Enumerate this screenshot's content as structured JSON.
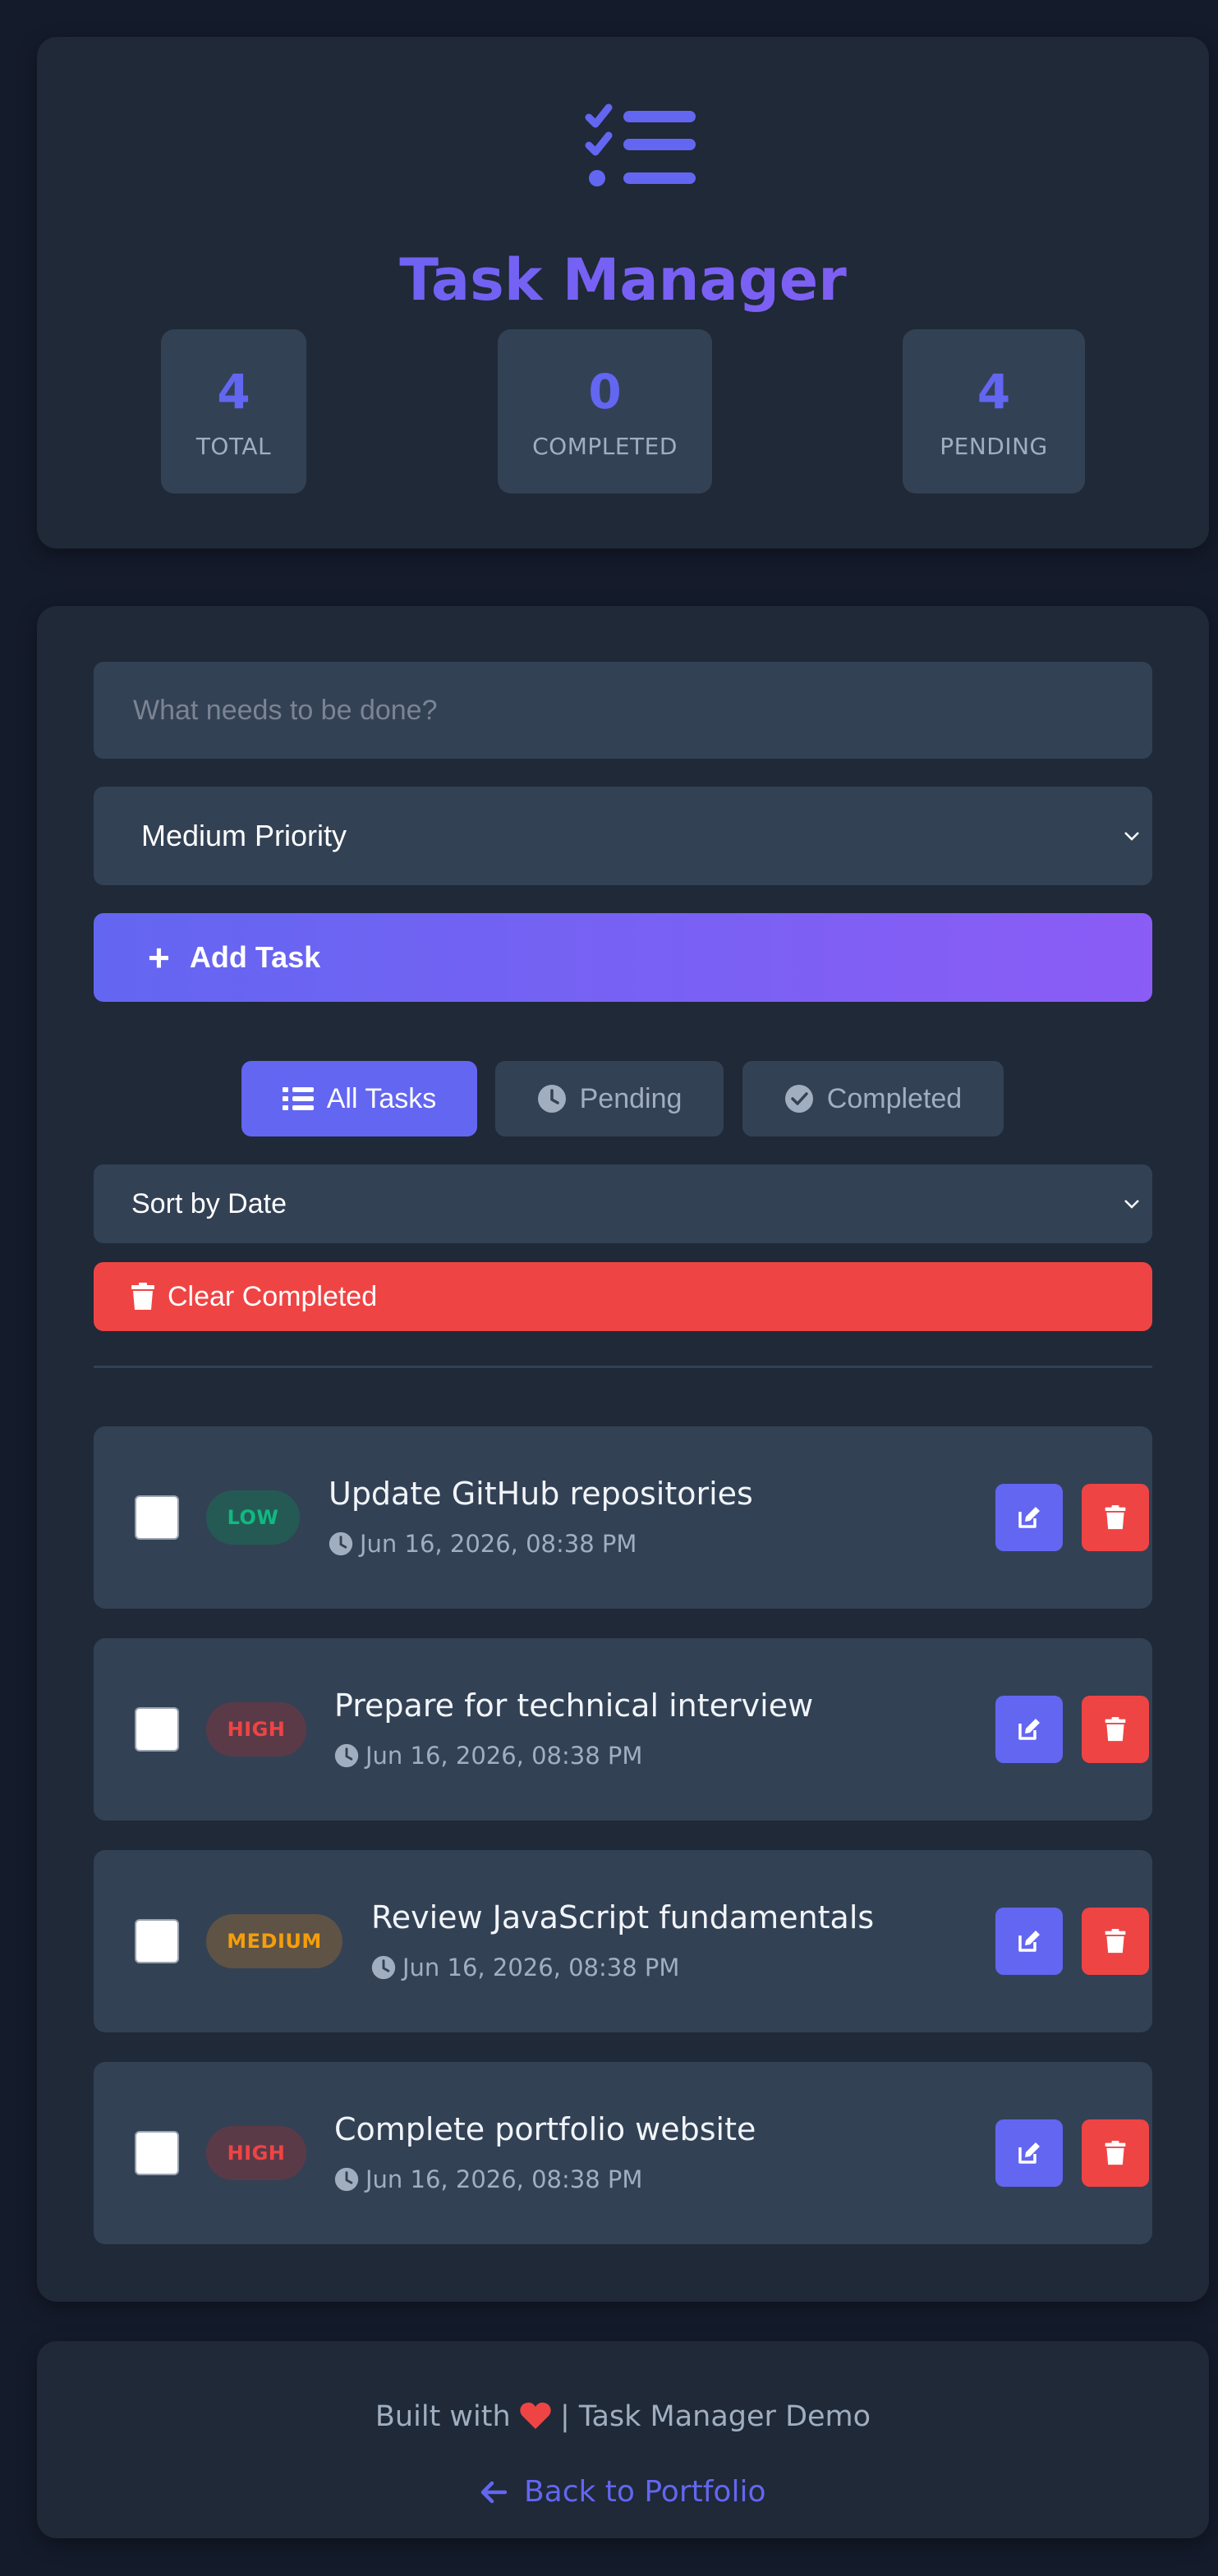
{
  "header": {
    "title": "Task Manager",
    "logo_icon": "tasks-icon",
    "stats": [
      {
        "value": "4",
        "label": "TOTAL"
      },
      {
        "value": "0",
        "label": "COMPLETED"
      },
      {
        "value": "4",
        "label": "PENDING"
      }
    ]
  },
  "form": {
    "task_placeholder": "What needs to be done?",
    "task_value": "",
    "priority_selected": "Medium Priority",
    "add_label": "Add Task"
  },
  "filters": [
    {
      "label": "All Tasks",
      "icon": "list-icon",
      "active": true
    },
    {
      "label": "Pending",
      "icon": "clock-icon",
      "active": false
    },
    {
      "label": "Completed",
      "icon": "check-circle-icon",
      "active": false
    }
  ],
  "sort_selected": "Sort by Date",
  "clear_label": "Clear Completed",
  "tasks": [
    {
      "priority": "LOW",
      "title": "Update GitHub repositories",
      "date": "Jun 16, 2026, 08:38 PM",
      "completed": false
    },
    {
      "priority": "HIGH",
      "title": "Prepare for technical interview",
      "date": "Jun 16, 2026, 08:38 PM",
      "completed": false
    },
    {
      "priority": "MEDIUM",
      "title": "Review JavaScript fundamentals",
      "date": "Jun 16, 2026, 08:38 PM",
      "completed": false
    },
    {
      "priority": "HIGH",
      "title": "Complete portfolio website",
      "date": "Jun 16, 2026, 08:38 PM",
      "completed": false
    }
  ],
  "footer": {
    "built_prefix": "Built with",
    "built_suffix": "| Task Manager Demo",
    "back_label": "Back to Portfolio"
  },
  "colors": {
    "accent": "#6366f1",
    "accent2": "#8b5cf6",
    "danger": "#ef4444",
    "low": "#10b981",
    "medium": "#f59e0b",
    "background": "#141b2b",
    "card": "#1f2937",
    "surface": "#334155"
  }
}
